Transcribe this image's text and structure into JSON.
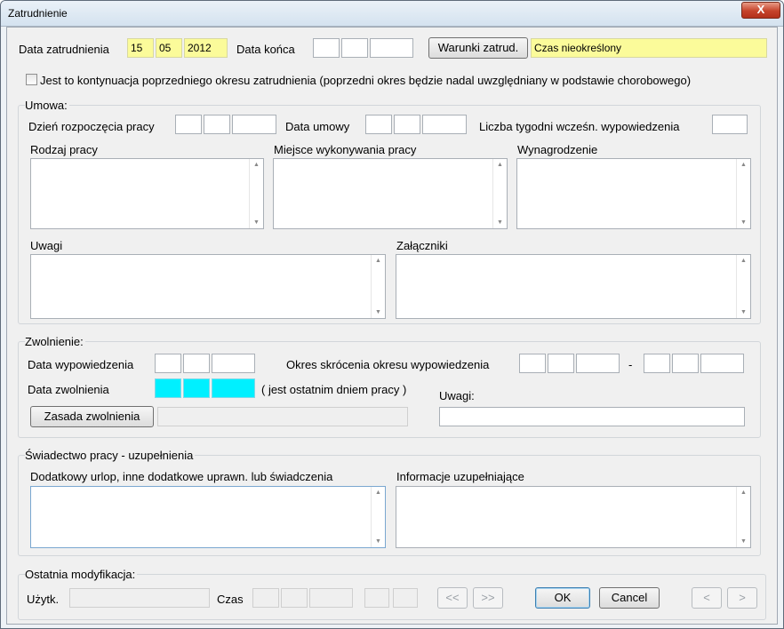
{
  "window": {
    "title": "Zatrudnienie",
    "close_symbol": "X"
  },
  "hire": {
    "label": "Data zatrudnienia",
    "day": "15",
    "month": "05",
    "year": "2012",
    "end_label": "Data końca",
    "terms_button": "Warunki zatrud.",
    "terms_value": "Czas nieokreślony"
  },
  "continuation": {
    "checked": false,
    "label": "Jest to kontynuacja poprzedniego okresu zatrudnienia (poprzedni okres będzie nadal uwzględniany w podstawie chorobowego)"
  },
  "umowa": {
    "title": "Umowa:",
    "start_label": "Dzień rozpoczęcia pracy",
    "contract_date_label": "Data umowy",
    "notice_weeks_label": "Liczba tygodni wcześn. wypowiedzenia",
    "work_type_label": "Rodzaj pracy",
    "work_place_label": "Miejsce wykonywania pracy",
    "salary_label": "Wynagrodzenie",
    "notes_label": "Uwagi",
    "attachments_label": "Załączniki"
  },
  "zwolnienie": {
    "title": "Zwolnienie:",
    "notice_date_label": "Data wypowiedzenia",
    "shortening_label": "Okres skrócenia okresu wypowiedzenia",
    "range_dash": "-",
    "dismissal_date_label": "Data zwolnienia",
    "last_day_note": "( jest ostatnim dniem pracy )",
    "rule_button": "Zasada zwolnienia",
    "notes_label": "Uwagi:"
  },
  "swiadectwo": {
    "title": "Świadectwo pracy - uzupełnienia",
    "extra_label": "Dodatkowy urlop, inne dodatkowe uprawn. lub świadczenia",
    "info_label": "Informacje uzupełniające"
  },
  "modyfikacja": {
    "title": "Ostatnia modyfikacja:",
    "user_label": "Użytk.",
    "time_label": "Czas",
    "prev_prev": "<<",
    "next_next": ">>",
    "ok": "OK",
    "cancel": "Cancel",
    "prev": "<",
    "next": ">"
  },
  "colors": {
    "highlight": "#fbfb9a",
    "dismissal_fill": "#00f0ff"
  }
}
